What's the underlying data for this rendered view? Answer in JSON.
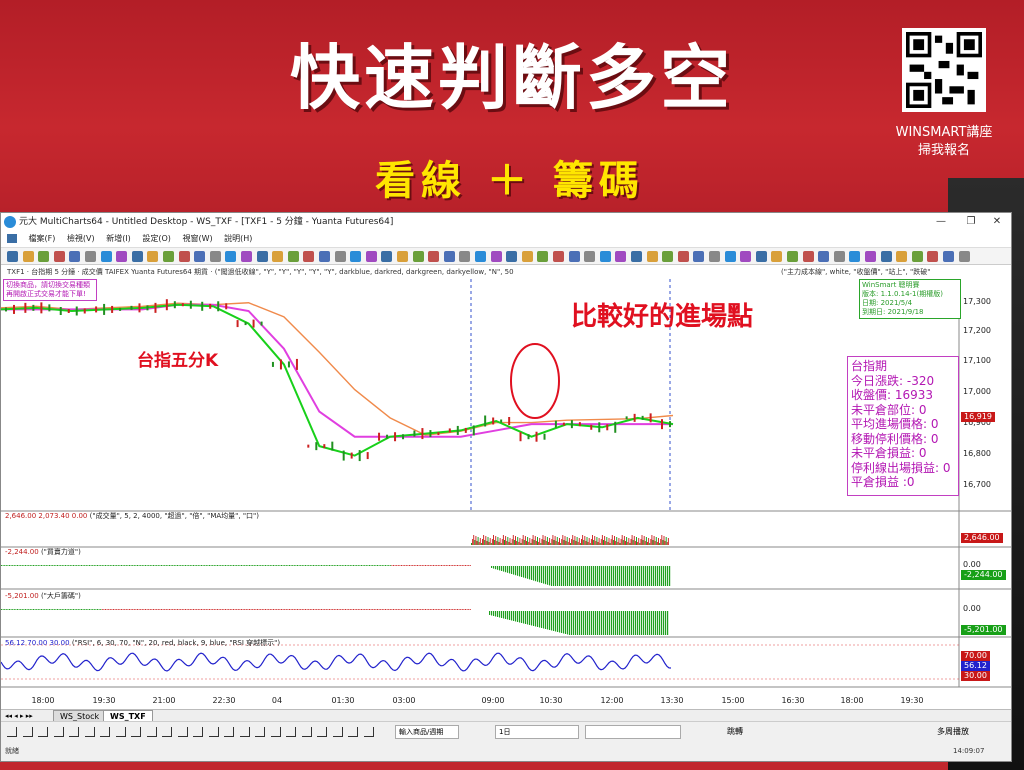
{
  "banner": {
    "title": "快速判斷多空",
    "subtitle": "看線 ＋ 籌碼",
    "qr_caption_line1": "WINSMART講座",
    "qr_caption_line2": "掃我報名"
  },
  "window": {
    "title": "元大 MultiCharts64 - Untitled Desktop - WS_TXF - [TXF1 - 5 分鐘 - Yuanta Futures64]",
    "controls": {
      "minimize": "—",
      "maximize": "❐",
      "close": "✕"
    }
  },
  "menu": [
    "檔案(F)",
    "檢視(V)",
    "新增(I)",
    "設定(O)",
    "視窗(W)",
    "說明(H)"
  ],
  "chart_header": "TXF1 · 台指期 5 分鐘 · 成交價 TAIFEX Yuanta Futures64 期貨 · (\"闖過低收線\", \"Y\", \"Y\", \"Y\", \"Y\", \"Y\", darkblue, darkred, darkgreen, darkyellow, \"N\", 50",
  "chart_header_right": "(\"主力成本線\", white, \"收盤價\", \"站上\", \"跌破\"",
  "warning_box": {
    "line1": "切換商品，請切換交易種類",
    "line2": "再開啟正式交易才能下單!"
  },
  "winsmart_box": {
    "line1": "WinSmart 聰明賽",
    "line2": "版本: 1.1.0.14-1(期權版)",
    "line3": "日期: 2021/5/4",
    "line4": "到期日: 2021/9/18"
  },
  "annotations": {
    "entry_point": "比較好的進場點",
    "label_5min": "台指五分K"
  },
  "info_panel": {
    "title": "台指期",
    "rows": [
      "今日漲跌: -320",
      "收盤價: 16933",
      "未平倉部位: 0",
      "平均進場價格: 0",
      "移動停利價格: 0",
      "未平倉損益: 0",
      "停利線出場損益: 0",
      "平倉損益 :0"
    ]
  },
  "price_axis": [
    "17,300",
    "17,200",
    "17,100",
    "17,000",
    "16,900",
    "16,800",
    "16,700"
  ],
  "price_tag": "16,919",
  "volume_header": {
    "left_values": "2,646.00  2,073.40  0.00",
    "formula": "(\"成交量\", 5, 2, 4000, \"超過\", \"倍\", \"MA均量\", \"口\")",
    "tag": "2,646.00"
  },
  "buysell_header": {
    "value": "-2,244.00",
    "formula": "(\"買賣力道\")",
    "tag": "-2,244.00",
    "zero": "0.00"
  },
  "bigplayer_header": {
    "value": "-5,201.00",
    "formula": "(\"大戶籌碼\")",
    "tag": "-5,201.00",
    "zero": "0.00"
  },
  "rsi_header": {
    "values": "56.12  70.00  30.00",
    "formula": "(\"RSI\", 6, 30, 70, \"N\", 20, red, black, 9, blue, \"RSI 穿越標示\")",
    "tags": [
      "70.00",
      "56.12",
      "30.00"
    ]
  },
  "time_axis": [
    "18:00",
    "19:30",
    "21:00",
    "22:30",
    "04",
    "01:30",
    "03:00",
    "09:00",
    "10:30",
    "12:00",
    "13:30",
    "15:00",
    "16:30",
    "18:00",
    "19:30"
  ],
  "tabs": [
    "WS_Stock",
    "WS_TXF"
  ],
  "drawbar": {
    "symbol_combo": "輸入商品/週期",
    "interval_combo": "1日",
    "jump_label": "跳轉",
    "replay_label": "多周播放"
  },
  "status": {
    "left": "就緒",
    "right": "14:09:07"
  },
  "colors": {
    "banner_red": "#c1272d",
    "title_yellow": "#ffe600",
    "ma_green": "#18d01a",
    "cost_magenta": "#e03fe0",
    "ma_orange": "#f08a4b",
    "rsi_blue": "#2222cc"
  },
  "chart_data": {
    "type": "line",
    "title": "",
    "series": [
      {
        "name": "收盤價",
        "values": [
          17285,
          17290,
          17280,
          17285,
          17290,
          17300,
          17295,
          17240,
          17110,
          16850,
          16820,
          16880,
          16890,
          16900,
          16930,
          16880,
          16920,
          16910,
          16940,
          16920
        ]
      },
      {
        "name": "主力成本線",
        "values": [
          17285,
          17285,
          17285,
          17285,
          17285,
          17300,
          17300,
          17280,
          17160,
          16960,
          16880,
          16880,
          16880,
          16880,
          16900,
          16920,
          16920,
          16920,
          16920,
          16920
        ]
      }
    ],
    "ylim": [
      16650,
      17350
    ]
  }
}
